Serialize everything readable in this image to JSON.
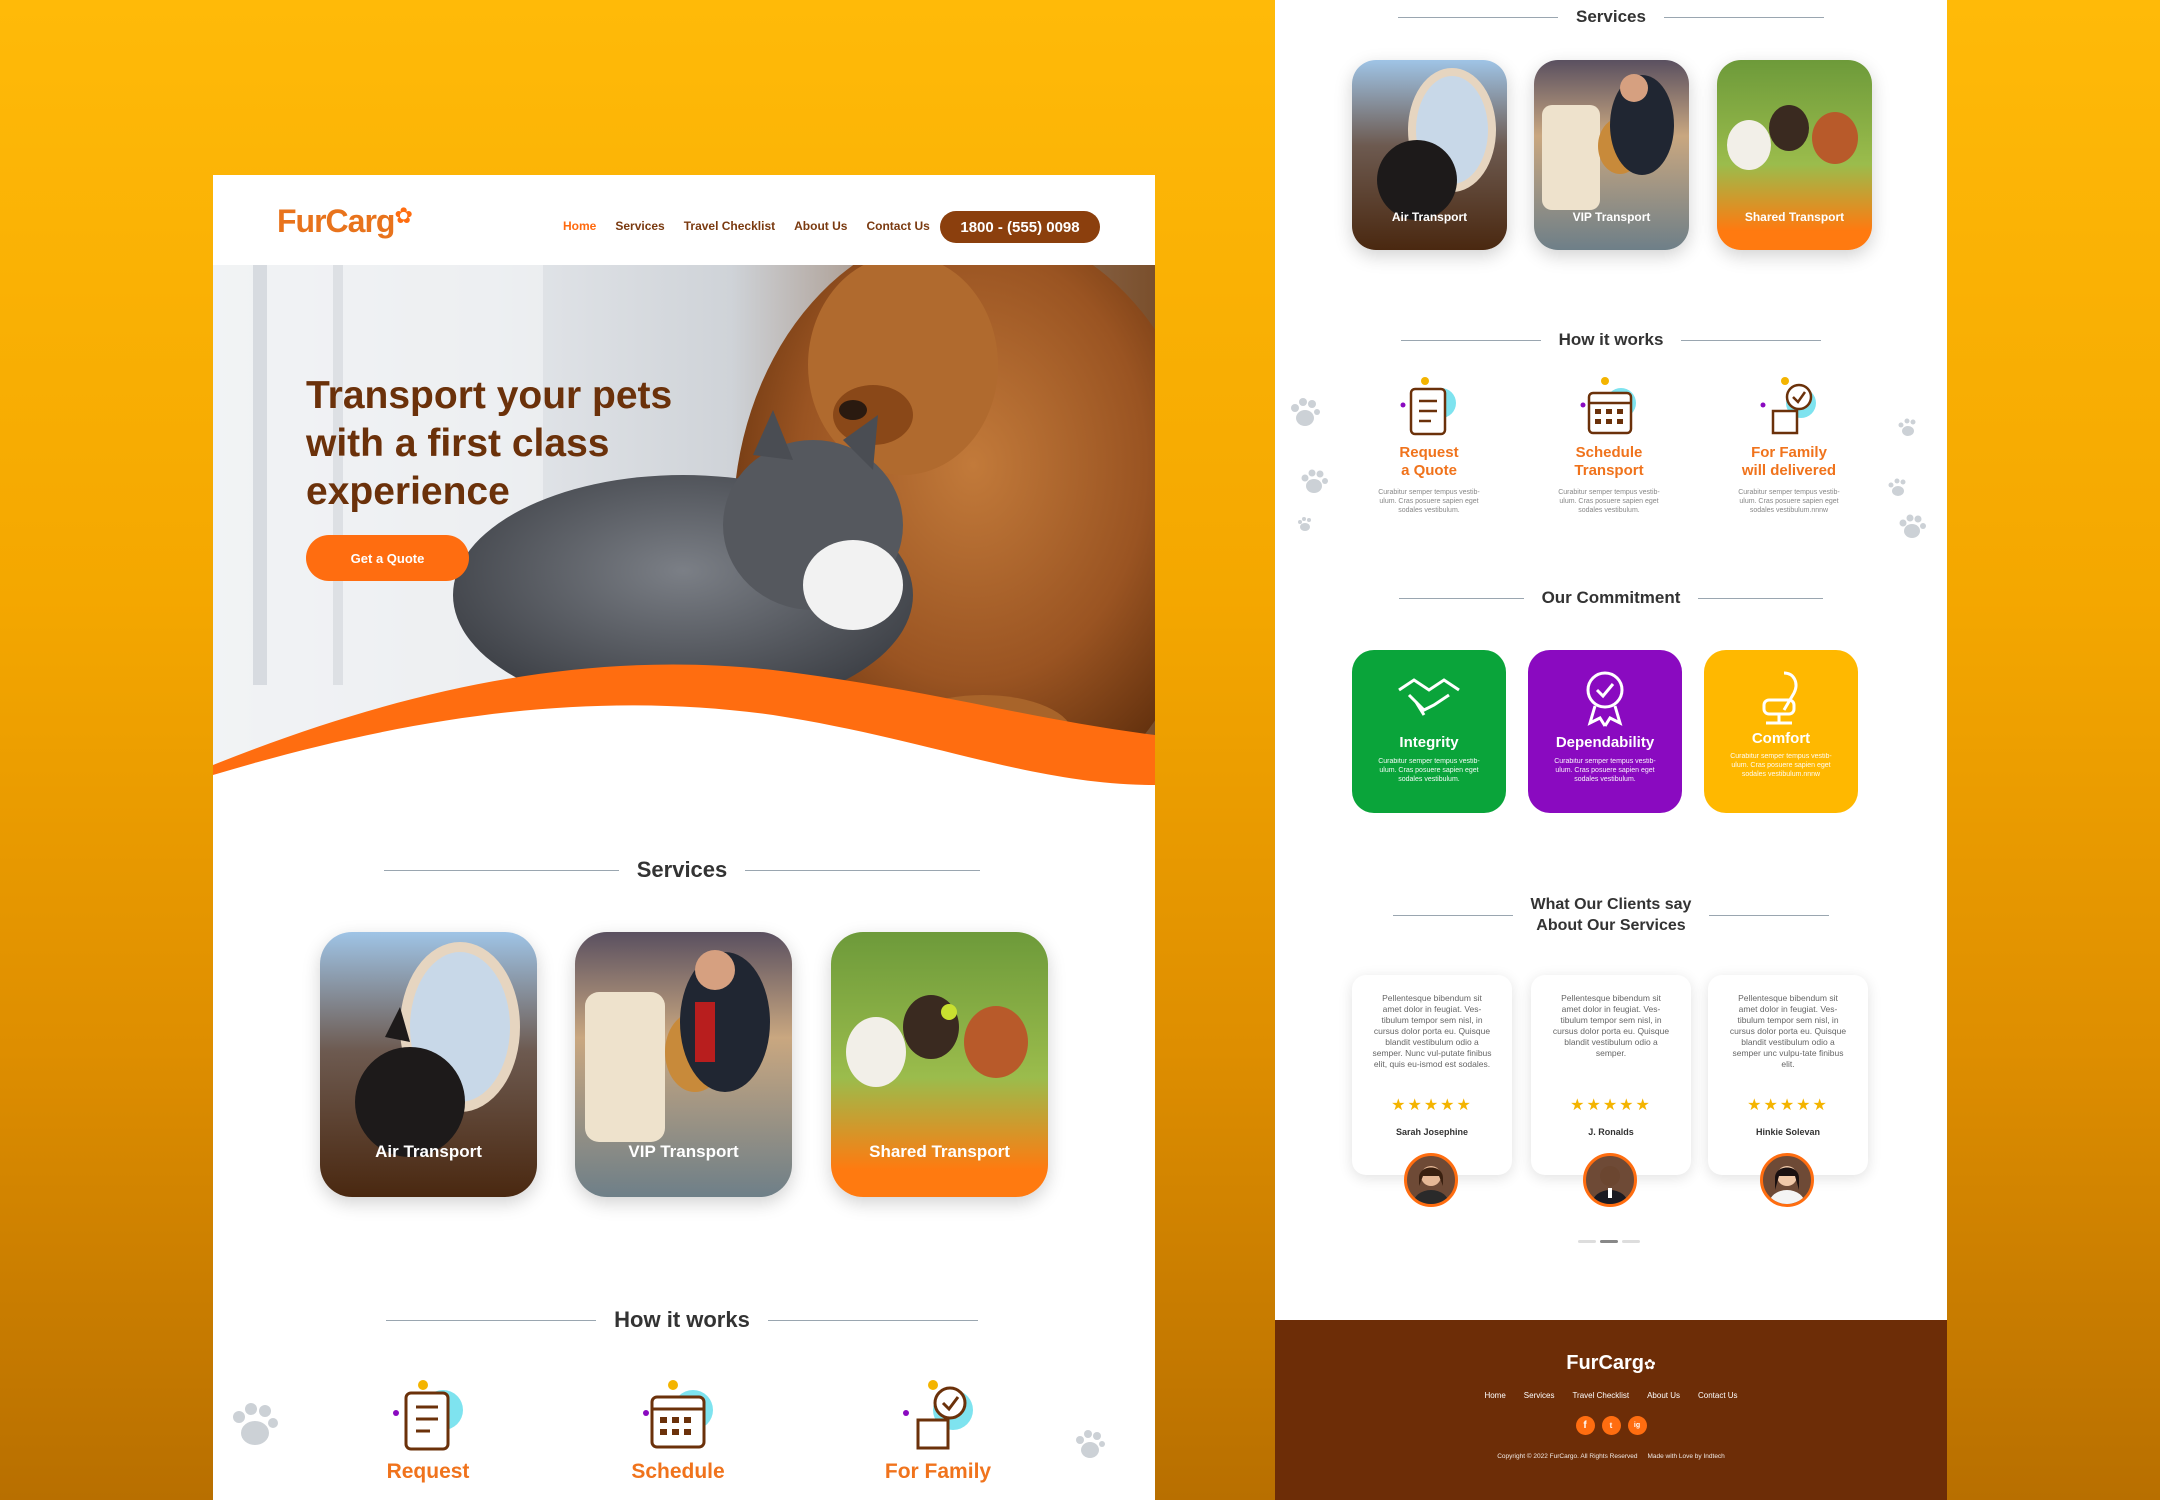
{
  "brand": {
    "name_a": "Fur",
    "name_b": "Carg",
    "accent": "#ff6d10",
    "dark": "#7a3a10"
  },
  "nav": {
    "links": [
      "Home",
      "Services",
      "Travel Checklist",
      "About Us",
      "Contact Us"
    ],
    "active": "Home",
    "phone": "1800 - (555) 0098"
  },
  "hero": {
    "title": "Transport your pets with a first class experience",
    "cta": "Get a Quote"
  },
  "services": {
    "title": "Services",
    "items": [
      "Air Transport",
      "VIP Transport",
      "Shared Transport"
    ]
  },
  "how": {
    "title": "How it works",
    "left_steps": [
      "Request",
      "Schedule",
      "For Family"
    ],
    "steps": [
      {
        "title_1": "Request",
        "title_2": "a Quote",
        "desc": "Curabitur semper tempus vestib-ulum. Cras posuere sapien eget sodales vestibulum."
      },
      {
        "title_1": "Schedule",
        "title_2": "Transport",
        "desc": "Curabitur semper tempus vestib-ulum. Cras posuere sapien eget sodales vestibulum."
      },
      {
        "title_1": "For Family",
        "title_2": "will delivered",
        "desc": "Curabitur semper tempus vestib-ulum. Cras posuere sapien eget sodales vestibulum.nnnw"
      }
    ]
  },
  "commitment": {
    "title": "Our Commitment",
    "items": [
      {
        "title": "Integrity",
        "desc": "Curabitur semper tempus vestib-ulum. Cras posuere sapien eget sodales vestibulum.",
        "color": "#0aa43a"
      },
      {
        "title": "Dependability",
        "desc": "Curabitur semper tempus vestib-ulum. Cras posuere sapien eget sodales vestibulum.",
        "color": "#8a0ac0"
      },
      {
        "title": "Comfort",
        "desc": "Curabitur semper tempus vestib-ulum. Cras posuere sapien eget sodales vestibulum.nnnw",
        "color": "#ffb800"
      }
    ]
  },
  "clients": {
    "title_1": "What Our Clients say",
    "title_2": "About Our Services",
    "items": [
      {
        "text": "Pellentesque bibendum sit amet dolor in feugiat. Ves-tibulum tempor sem nisl, in cursus dolor porta eu. Quisque blandit vestibulum odio a semper. Nunc vul-putate finibus elit, quis eu-ismod est sodales.",
        "stars": "★★★★★",
        "name": "Sarah Josephine"
      },
      {
        "text": "Pellentesque bibendum sit amet dolor in feugiat. Ves-tibulum tempor sem nisl, in cursus dolor porta eu. Quisque blandit vestibulum odio a semper.",
        "stars": "★★★★★",
        "name": "J. Ronalds"
      },
      {
        "text": "Pellentesque bibendum sit amet dolor in feugiat. Ves-tibulum tempor sem nisl, in cursus dolor porta eu. Quisque blandit vestibulum odio a semper unc vulpu-tate finibus elit.",
        "stars": "★★★★★",
        "name": "Hinkie Solevan"
      }
    ]
  },
  "footer": {
    "links": [
      "Home",
      "Services",
      "Travel Checklist",
      "About Us",
      "Contact Us"
    ],
    "social": [
      "f",
      "t",
      "ig"
    ],
    "copyright": "Copyright © 2022 FurCargo. All Rights Reserved",
    "madeby": "Made with Love by Indtech"
  }
}
